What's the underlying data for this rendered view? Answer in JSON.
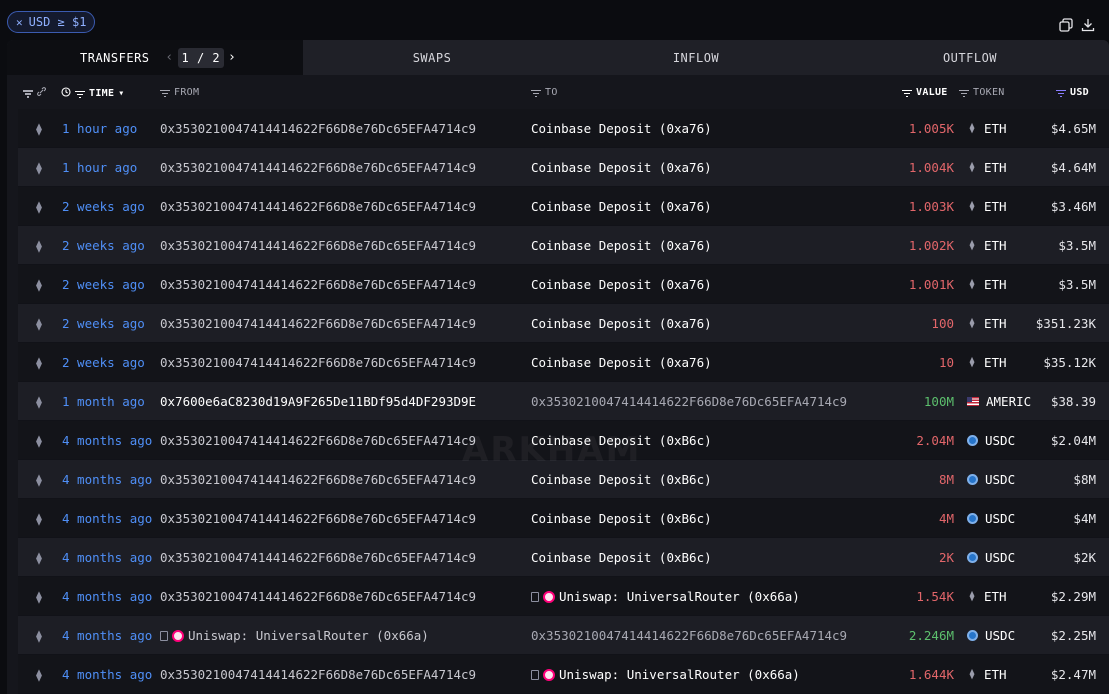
{
  "filter": {
    "label": "USD ≥ $1"
  },
  "icons": {
    "close": "close-icon",
    "copy": "copy-icon",
    "download": "download-icon"
  },
  "tabs": {
    "transfers": "TRANSFERS",
    "swaps": "SWAPS",
    "inflow": "INFLOW",
    "outflow": "OUTFLOW"
  },
  "pager": {
    "text": "1 / 2",
    "prev": "‹",
    "next": "›"
  },
  "columns": {
    "time": "TIME",
    "from": "FROM",
    "to": "TO",
    "value": "VALUE",
    "token": "TOKEN",
    "usd": "USD"
  },
  "watermark": "ARKHAM",
  "colors": {
    "accent": "#4f8ff7",
    "out": "#e2666a",
    "in": "#5cbf6d"
  },
  "rows": [
    {
      "time": "1 hour ago",
      "from": "0x3530210047414414622F66D8e76Dc65EFA4714c9",
      "to": "Coinbase Deposit (0xa76)",
      "value": "1.005K",
      "token": "ETH",
      "usd": "$4.65M"
    },
    {
      "time": "1 hour ago",
      "from": "0x3530210047414414622F66D8e76Dc65EFA4714c9",
      "to": "Coinbase Deposit (0xa76)",
      "value": "1.004K",
      "token": "ETH",
      "usd": "$4.64M"
    },
    {
      "time": "2 weeks ago",
      "from": "0x3530210047414414622F66D8e76Dc65EFA4714c9",
      "to": "Coinbase Deposit (0xa76)",
      "value": "1.003K",
      "token": "ETH",
      "usd": "$3.46M"
    },
    {
      "time": "2 weeks ago",
      "from": "0x3530210047414414622F66D8e76Dc65EFA4714c9",
      "to": "Coinbase Deposit (0xa76)",
      "value": "1.002K",
      "token": "ETH",
      "usd": "$3.5M"
    },
    {
      "time": "2 weeks ago",
      "from": "0x3530210047414414622F66D8e76Dc65EFA4714c9",
      "to": "Coinbase Deposit (0xa76)",
      "value": "1.001K",
      "token": "ETH",
      "usd": "$3.5M"
    },
    {
      "time": "2 weeks ago",
      "from": "0x3530210047414414622F66D8e76Dc65EFA4714c9",
      "to": "Coinbase Deposit (0xa76)",
      "value": "100",
      "token": "ETH",
      "usd": "$351.23K"
    },
    {
      "time": "2 weeks ago",
      "from": "0x3530210047414414622F66D8e76Dc65EFA4714c9",
      "to": "Coinbase Deposit (0xa76)",
      "value": "10",
      "token": "ETH",
      "usd": "$35.12K"
    },
    {
      "time": "1 month ago",
      "from": "0x7600e6aC8230d19A9F265De11BDf95d4DF293D9E",
      "to": "0x3530210047414414622F66D8e76Dc65EFA4714c9",
      "value": "100M",
      "token": "AMERIC",
      "usd": "$38.39"
    },
    {
      "time": "4 months ago",
      "from": "0x3530210047414414622F66D8e76Dc65EFA4714c9",
      "to": "Coinbase Deposit (0xB6c)",
      "value": "2.04M",
      "token": "USDC",
      "usd": "$2.04M"
    },
    {
      "time": "4 months ago",
      "from": "0x3530210047414414622F66D8e76Dc65EFA4714c9",
      "to": "Coinbase Deposit (0xB6c)",
      "value": "8M",
      "token": "USDC",
      "usd": "$8M"
    },
    {
      "time": "4 months ago",
      "from": "0x3530210047414414622F66D8e76Dc65EFA4714c9",
      "to": "Coinbase Deposit (0xB6c)",
      "value": "4M",
      "token": "USDC",
      "usd": "$4M"
    },
    {
      "time": "4 months ago",
      "from": "0x3530210047414414622F66D8e76Dc65EFA4714c9",
      "to": "Coinbase Deposit (0xB6c)",
      "value": "2K",
      "token": "USDC",
      "usd": "$2K"
    },
    {
      "time": "4 months ago",
      "from": "0x3530210047414414622F66D8e76Dc65EFA4714c9",
      "to": "Uniswap: UniversalRouter (0x66a)",
      "value": "1.54K",
      "token": "ETH",
      "usd": "$2.29M"
    },
    {
      "time": "4 months ago",
      "from": "Uniswap: UniversalRouter (0x66a)",
      "to": "0x3530210047414414622F66D8e76Dc65EFA4714c9",
      "value": "2.246M",
      "token": "USDC",
      "usd": "$2.25M"
    },
    {
      "time": "4 months ago",
      "from": "0x3530210047414414622F66D8e76Dc65EFA4714c9",
      "to": "Uniswap: UniversalRouter (0x66a)",
      "value": "1.644K",
      "token": "ETH",
      "usd": "$2.47M"
    }
  ]
}
